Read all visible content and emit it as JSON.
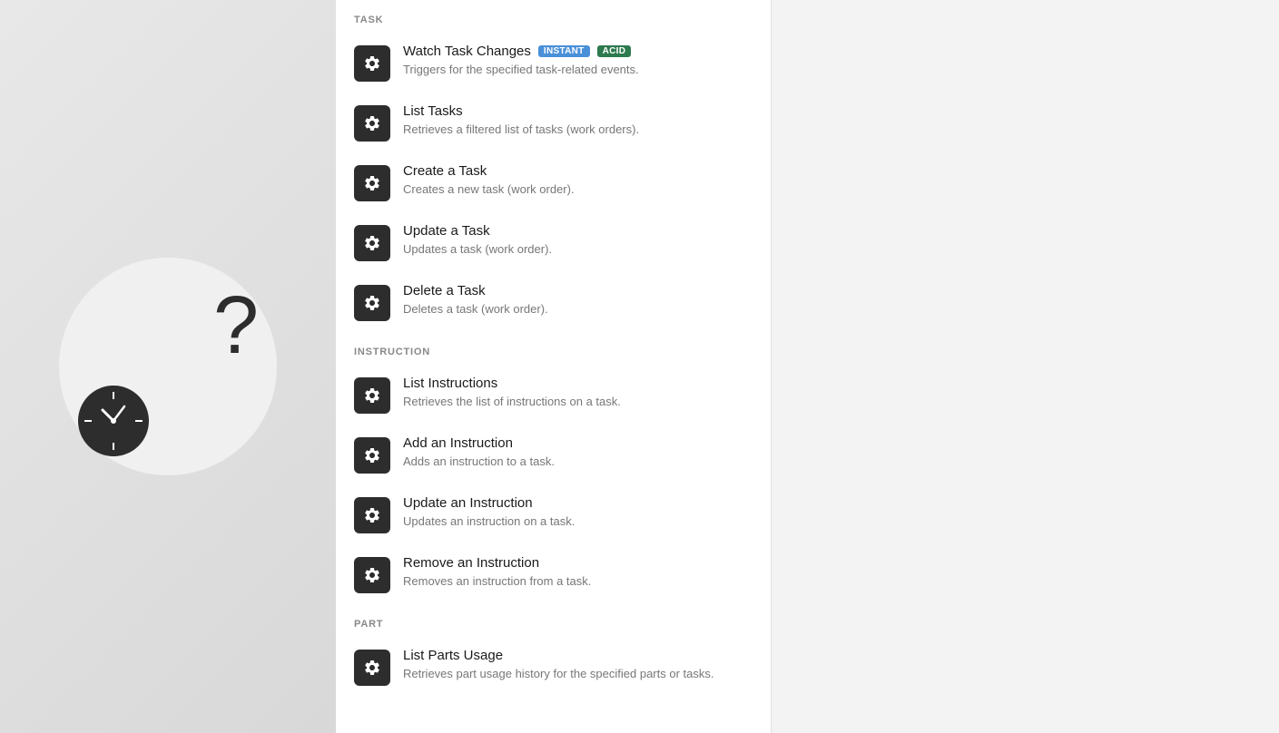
{
  "sections": [
    {
      "id": "task",
      "header": "TASK",
      "items": [
        {
          "id": "watch-task-changes",
          "title": "Watch Task Changes",
          "description": "Triggers for the specified task-related events.",
          "badges": [
            {
              "label": "INSTANT",
              "type": "instant"
            },
            {
              "label": "ACID",
              "type": "acid"
            }
          ]
        },
        {
          "id": "list-tasks",
          "title": "List Tasks",
          "description": "Retrieves a filtered list of tasks (work orders).",
          "badges": []
        },
        {
          "id": "create-a-task",
          "title": "Create a Task",
          "description": "Creates a new task (work order).",
          "badges": []
        },
        {
          "id": "update-a-task",
          "title": "Update a Task",
          "description": "Updates a task (work order).",
          "badges": []
        },
        {
          "id": "delete-a-task",
          "title": "Delete a Task",
          "description": "Deletes a task (work order).",
          "badges": []
        }
      ]
    },
    {
      "id": "instruction",
      "header": "INSTRUCTION",
      "items": [
        {
          "id": "list-instructions",
          "title": "List Instructions",
          "description": "Retrieves the list of instructions on a task.",
          "badges": []
        },
        {
          "id": "add-an-instruction",
          "title": "Add an Instruction",
          "description": "Adds an instruction to a task.",
          "badges": []
        },
        {
          "id": "update-an-instruction",
          "title": "Update an Instruction",
          "description": "Updates an instruction on a task.",
          "badges": []
        },
        {
          "id": "remove-an-instruction",
          "title": "Remove an Instruction",
          "description": "Removes an instruction from a task.",
          "badges": []
        }
      ]
    },
    {
      "id": "part",
      "header": "PART",
      "items": [
        {
          "id": "list-parts-usage",
          "title": "List Parts Usage",
          "description": "Retrieves part usage history for the specified parts or tasks.",
          "badges": []
        }
      ]
    }
  ]
}
